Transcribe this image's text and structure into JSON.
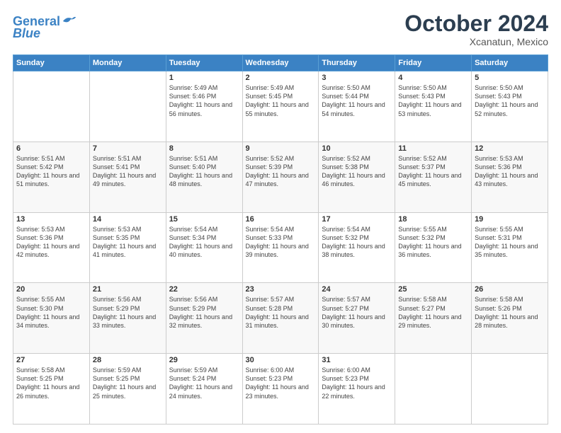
{
  "header": {
    "logo_line1": "General",
    "logo_line2": "Blue",
    "month": "October 2024",
    "location": "Xcanatun, Mexico"
  },
  "days_of_week": [
    "Sunday",
    "Monday",
    "Tuesday",
    "Wednesday",
    "Thursday",
    "Friday",
    "Saturday"
  ],
  "weeks": [
    [
      {
        "num": "",
        "detail": ""
      },
      {
        "num": "",
        "detail": ""
      },
      {
        "num": "1",
        "detail": "Sunrise: 5:49 AM\nSunset: 5:46 PM\nDaylight: 11 hours and 56 minutes."
      },
      {
        "num": "2",
        "detail": "Sunrise: 5:49 AM\nSunset: 5:45 PM\nDaylight: 11 hours and 55 minutes."
      },
      {
        "num": "3",
        "detail": "Sunrise: 5:50 AM\nSunset: 5:44 PM\nDaylight: 11 hours and 54 minutes."
      },
      {
        "num": "4",
        "detail": "Sunrise: 5:50 AM\nSunset: 5:43 PM\nDaylight: 11 hours and 53 minutes."
      },
      {
        "num": "5",
        "detail": "Sunrise: 5:50 AM\nSunset: 5:43 PM\nDaylight: 11 hours and 52 minutes."
      }
    ],
    [
      {
        "num": "6",
        "detail": "Sunrise: 5:51 AM\nSunset: 5:42 PM\nDaylight: 11 hours and 51 minutes."
      },
      {
        "num": "7",
        "detail": "Sunrise: 5:51 AM\nSunset: 5:41 PM\nDaylight: 11 hours and 49 minutes."
      },
      {
        "num": "8",
        "detail": "Sunrise: 5:51 AM\nSunset: 5:40 PM\nDaylight: 11 hours and 48 minutes."
      },
      {
        "num": "9",
        "detail": "Sunrise: 5:52 AM\nSunset: 5:39 PM\nDaylight: 11 hours and 47 minutes."
      },
      {
        "num": "10",
        "detail": "Sunrise: 5:52 AM\nSunset: 5:38 PM\nDaylight: 11 hours and 46 minutes."
      },
      {
        "num": "11",
        "detail": "Sunrise: 5:52 AM\nSunset: 5:37 PM\nDaylight: 11 hours and 45 minutes."
      },
      {
        "num": "12",
        "detail": "Sunrise: 5:53 AM\nSunset: 5:36 PM\nDaylight: 11 hours and 43 minutes."
      }
    ],
    [
      {
        "num": "13",
        "detail": "Sunrise: 5:53 AM\nSunset: 5:36 PM\nDaylight: 11 hours and 42 minutes."
      },
      {
        "num": "14",
        "detail": "Sunrise: 5:53 AM\nSunset: 5:35 PM\nDaylight: 11 hours and 41 minutes."
      },
      {
        "num": "15",
        "detail": "Sunrise: 5:54 AM\nSunset: 5:34 PM\nDaylight: 11 hours and 40 minutes."
      },
      {
        "num": "16",
        "detail": "Sunrise: 5:54 AM\nSunset: 5:33 PM\nDaylight: 11 hours and 39 minutes."
      },
      {
        "num": "17",
        "detail": "Sunrise: 5:54 AM\nSunset: 5:32 PM\nDaylight: 11 hours and 38 minutes."
      },
      {
        "num": "18",
        "detail": "Sunrise: 5:55 AM\nSunset: 5:32 PM\nDaylight: 11 hours and 36 minutes."
      },
      {
        "num": "19",
        "detail": "Sunrise: 5:55 AM\nSunset: 5:31 PM\nDaylight: 11 hours and 35 minutes."
      }
    ],
    [
      {
        "num": "20",
        "detail": "Sunrise: 5:55 AM\nSunset: 5:30 PM\nDaylight: 11 hours and 34 minutes."
      },
      {
        "num": "21",
        "detail": "Sunrise: 5:56 AM\nSunset: 5:29 PM\nDaylight: 11 hours and 33 minutes."
      },
      {
        "num": "22",
        "detail": "Sunrise: 5:56 AM\nSunset: 5:29 PM\nDaylight: 11 hours and 32 minutes."
      },
      {
        "num": "23",
        "detail": "Sunrise: 5:57 AM\nSunset: 5:28 PM\nDaylight: 11 hours and 31 minutes."
      },
      {
        "num": "24",
        "detail": "Sunrise: 5:57 AM\nSunset: 5:27 PM\nDaylight: 11 hours and 30 minutes."
      },
      {
        "num": "25",
        "detail": "Sunrise: 5:58 AM\nSunset: 5:27 PM\nDaylight: 11 hours and 29 minutes."
      },
      {
        "num": "26",
        "detail": "Sunrise: 5:58 AM\nSunset: 5:26 PM\nDaylight: 11 hours and 28 minutes."
      }
    ],
    [
      {
        "num": "27",
        "detail": "Sunrise: 5:58 AM\nSunset: 5:25 PM\nDaylight: 11 hours and 26 minutes."
      },
      {
        "num": "28",
        "detail": "Sunrise: 5:59 AM\nSunset: 5:25 PM\nDaylight: 11 hours and 25 minutes."
      },
      {
        "num": "29",
        "detail": "Sunrise: 5:59 AM\nSunset: 5:24 PM\nDaylight: 11 hours and 24 minutes."
      },
      {
        "num": "30",
        "detail": "Sunrise: 6:00 AM\nSunset: 5:23 PM\nDaylight: 11 hours and 23 minutes."
      },
      {
        "num": "31",
        "detail": "Sunrise: 6:00 AM\nSunset: 5:23 PM\nDaylight: 11 hours and 22 minutes."
      },
      {
        "num": "",
        "detail": ""
      },
      {
        "num": "",
        "detail": ""
      }
    ]
  ]
}
